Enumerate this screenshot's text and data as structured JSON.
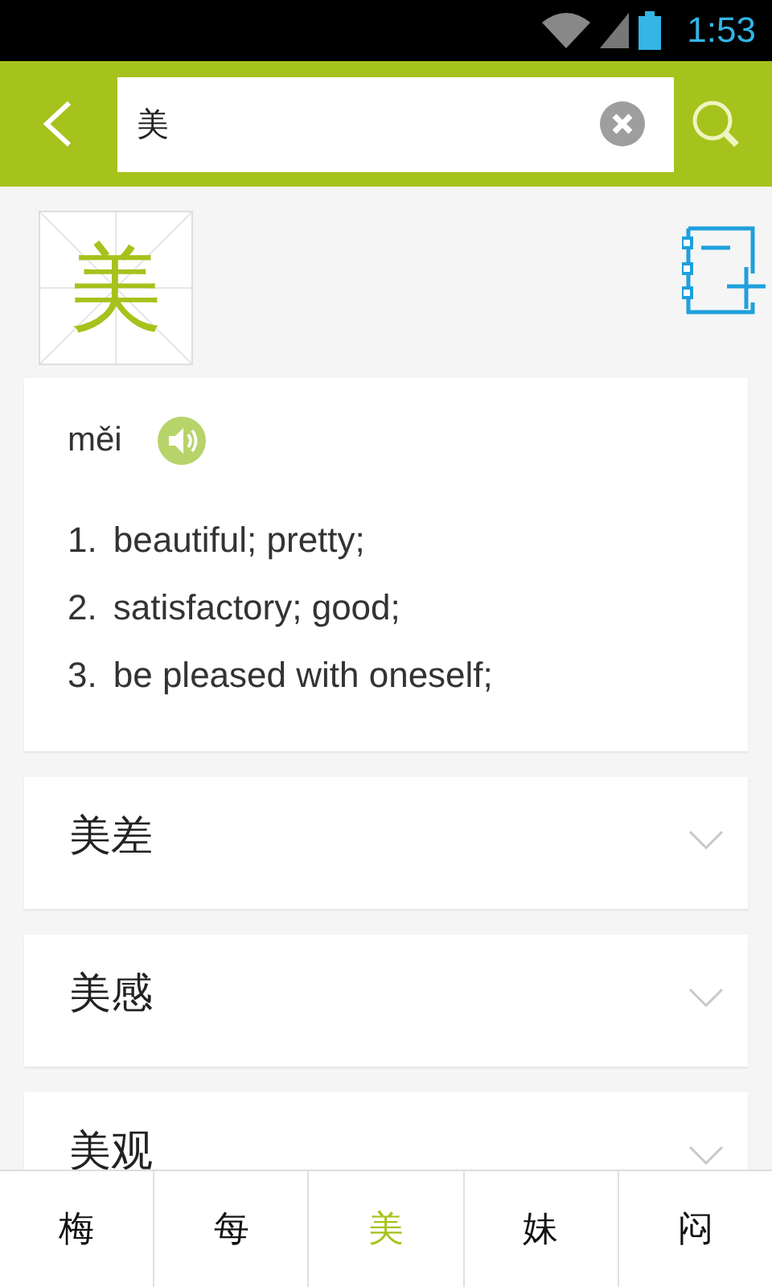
{
  "status_bar": {
    "time": "1:53"
  },
  "search": {
    "value": "美"
  },
  "character": {
    "glyph": "美"
  },
  "definition": {
    "pinyin": "měi",
    "senses": [
      {
        "number": "1.",
        "text": "beautiful; pretty;"
      },
      {
        "number": "2.",
        "text": "satisfactory; good;"
      },
      {
        "number": "3.",
        "text": "be pleased with oneself;"
      }
    ]
  },
  "words": [
    {
      "text": "美差",
      "expanded": false
    },
    {
      "text": "美感",
      "expanded": false
    },
    {
      "text": "美观",
      "expanded": false
    }
  ],
  "related_tabs": [
    {
      "label": "梅",
      "selected": false
    },
    {
      "label": "每",
      "selected": false
    },
    {
      "label": "美",
      "selected": true
    },
    {
      "label": "妹",
      "selected": false
    },
    {
      "label": "闷",
      "selected": false
    }
  ]
}
